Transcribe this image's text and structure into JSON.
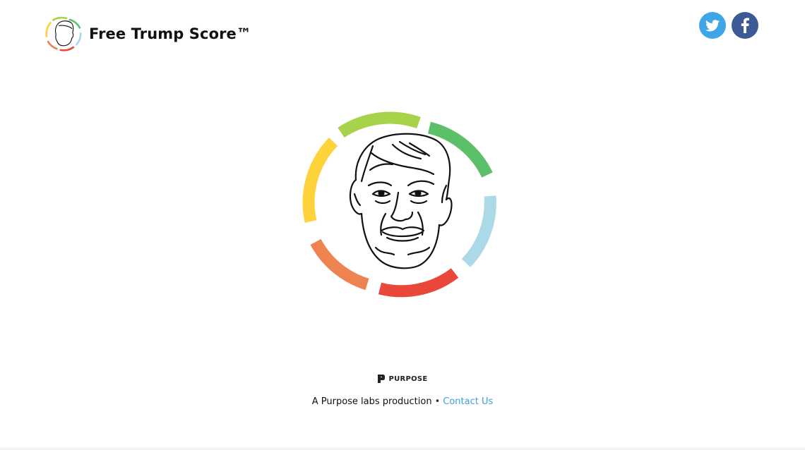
{
  "header": {
    "title": "Free Trump Score™",
    "logo_icon": "trump-face-ring-icon"
  },
  "social": {
    "twitter_icon": "twitter-icon",
    "facebook_icon": "facebook-icon",
    "twitter_color": "#3ea6e6",
    "facebook_color": "#3b5a96"
  },
  "hero": {
    "icon": "trump-face-icon",
    "ring_colors": [
      "#a6d34a",
      "#5cbf6a",
      "#acd9e8",
      "#e8473a",
      "#ec8350",
      "#fdd23a"
    ]
  },
  "footer": {
    "brand": "PURPOSE",
    "credit_text": "A Purpose labs production",
    "separator": "•",
    "contact_label": "Contact Us",
    "link_color": "#3ea0dc"
  }
}
